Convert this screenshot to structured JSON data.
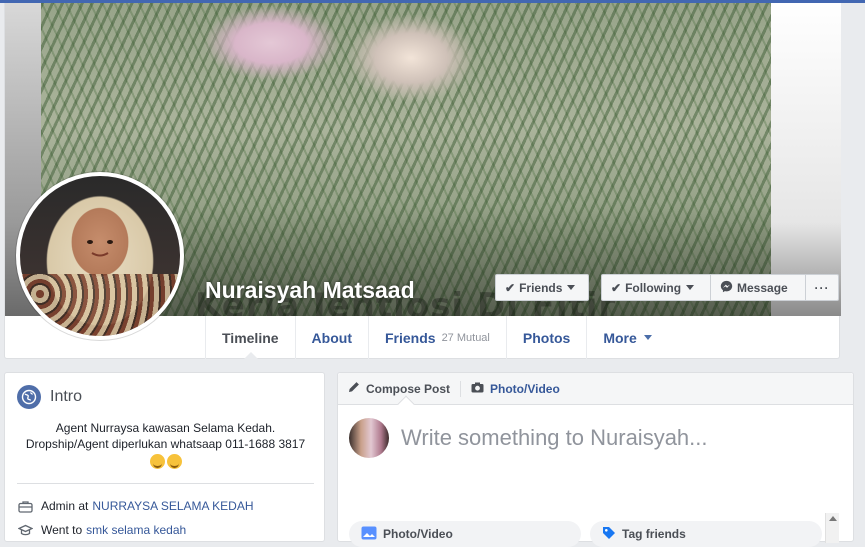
{
  "profile": {
    "name": "Nuraisyah Matsaad",
    "cover_watermark": "Kerja Jentiosi Di Fitir"
  },
  "actions": {
    "friends_label": "Friends",
    "following_label": "Following",
    "message_label": "Message",
    "more_label": "···"
  },
  "nav": {
    "timeline": "Timeline",
    "about": "About",
    "friends": "Friends",
    "friends_mutual": "27 Mutual",
    "photos": "Photos",
    "more": "More"
  },
  "intro": {
    "title": "Intro",
    "bio_line1": "Agent Nurraysa kawasan Selama Kedah.",
    "bio_line2": "Dropship/Agent diperlukan whatsaap 011-1688 3817",
    "work_prefix": "Admin at",
    "work_link": "NURRAYSA SELAMA KEDAH",
    "school_prefix": "Went to",
    "school_link": "smk selama kedah"
  },
  "composer": {
    "tab_compose": "Compose Post",
    "tab_photo": "Photo/Video",
    "placeholder": "Write something to Nuraisyah...",
    "btn_photo": "Photo/Video",
    "btn_tag": "Tag friends"
  },
  "colors": {
    "brand_blue": "#4267b2",
    "link_blue": "#365899",
    "page_bg": "#e9ebee"
  }
}
